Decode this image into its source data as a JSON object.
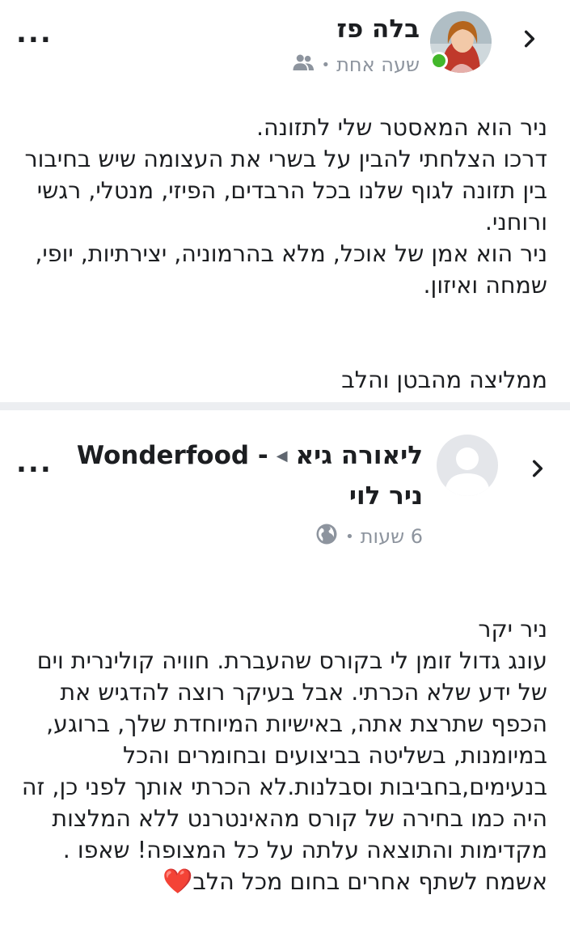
{
  "post1": {
    "author": "בלה פז",
    "time": "שעה אחת",
    "audience_icon": "friends-icon",
    "paragraph1": "ניר הוא המאסטר שלי לתזונה.\nדרכו הצלחתי להבין על בשרי את העצומה שיש בחיבור בין תזונה לגוף שלנו בכל הרבדים, הפיזי, מנטלי, רגשי ורוחני.\nניר הוא אמן של אוכל, מלא בהרמוניה, יצירתיות, יופי, שמחה ואיזון.",
    "paragraph2": "ממליצה מהבטן והלב"
  },
  "post2": {
    "author": "ליאורה גיא",
    "target_line1": "Wonderfood -",
    "target_line2": "ניר לוי",
    "time": "6 שעות",
    "audience_icon": "globe-icon",
    "text": "ניר יקר\nעונג גדול זומן לי בקורס שהעברת. חוויה קולינרית וים של ידע שלא הכרתי. אבל בעיקר רוצה להדגיש את הכפף שתרצת אתה, באישיות המיוחדת שלך, ברוגע, במיומנות, בשליטה בביצועים ובחומרים והכל בנעימים,בחביבות וסבלנות.לא הכרתי אותך לפני כן, זה היה כמו בחירה של קורס מהאינטרנט ללא המלצות מקדימות והתוצאה עלתה על כל המצופה! שאפו .\nאשמח לשתף אחרים בחום מכל הלב",
    "heart": "❤️"
  },
  "colors": {
    "online": "#42b72a",
    "meta_gray": "#8d949e",
    "separator": "#eceef1",
    "heart": "#e0242b"
  }
}
